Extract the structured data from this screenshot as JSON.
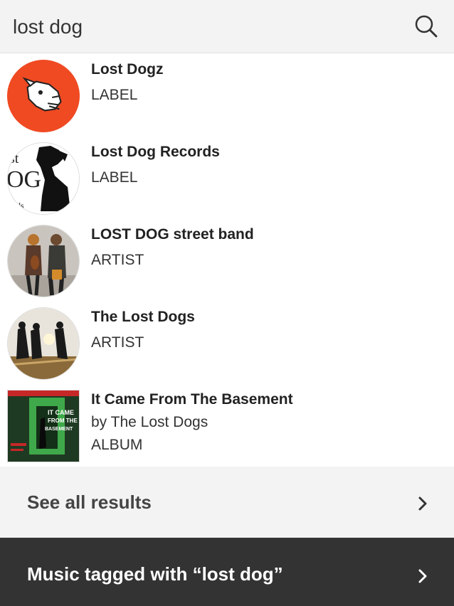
{
  "search": {
    "value": "lost dog"
  },
  "results": [
    {
      "title": "Lost Dogz",
      "lines": [
        "LABEL"
      ]
    },
    {
      "title": "Lost Dog Records",
      "lines": [
        "LABEL"
      ],
      "thumb_text": [
        "st",
        "OG",
        "rds"
      ]
    },
    {
      "title": "LOST DOG street band",
      "lines": [
        "ARTIST"
      ]
    },
    {
      "title": "The Lost Dogs",
      "lines": [
        "ARTIST"
      ]
    },
    {
      "title": "It Came From The Basement",
      "lines": [
        "by The Lost Dogs",
        "ALBUM"
      ],
      "cover_text": [
        "IT CAME",
        "FROM THE",
        "BASEMENT"
      ]
    }
  ],
  "see_all": {
    "label": "See all results"
  },
  "tagged": {
    "label": "Music tagged with “lost dog”"
  },
  "colors": {
    "lost_dogz_bg": "#f04a23",
    "footer_dark": "#333333",
    "panel_grey": "#f3f3f3"
  },
  "icons": [
    "search-icon",
    "chevron-right-icon"
  ]
}
